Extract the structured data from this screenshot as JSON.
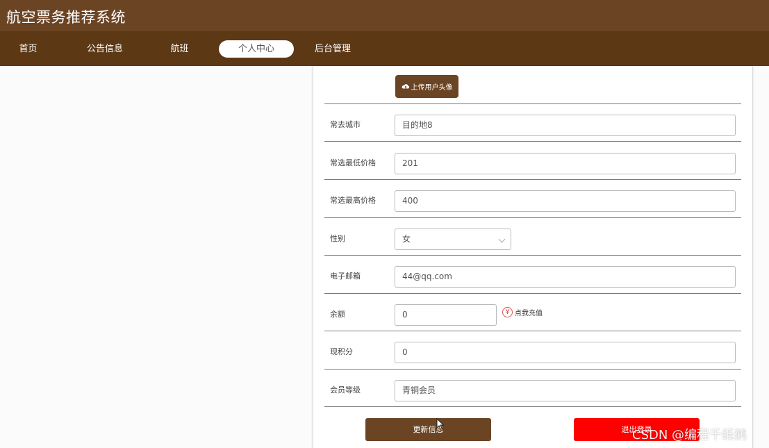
{
  "app": {
    "title": "航空票务推荐系统"
  },
  "nav": {
    "items": [
      {
        "label": "首页"
      },
      {
        "label": "公告信息"
      },
      {
        "label": "航班"
      },
      {
        "label": "个人中心",
        "active": true
      },
      {
        "label": "后台管理"
      }
    ]
  },
  "profile": {
    "upload_avatar_label": "上传用户头像",
    "fields": {
      "city": {
        "label": "常去城市",
        "value": "目的地8"
      },
      "min_price": {
        "label": "常选最低价格",
        "value": "201"
      },
      "max_price": {
        "label": "常选最高价格",
        "value": "400"
      },
      "gender": {
        "label": "性别",
        "value": "女"
      },
      "email": {
        "label": "电子邮箱",
        "value": "44@qq.com"
      },
      "balance": {
        "label": "余额",
        "value": "0"
      },
      "points": {
        "label": "现积分",
        "value": "0"
      },
      "level": {
        "label": "会员等级",
        "value": "青铜会员"
      }
    },
    "recharge_label": "点我充值",
    "recharge_icon_glyph": "¥"
  },
  "actions": {
    "update_label": "更新信息",
    "logout_label": "退出登录"
  },
  "watermark": "CSDN @编程千纸鹤",
  "colors": {
    "brand_brown": "#6b4424",
    "nav_brown": "#5c3815",
    "logout_red": "#ff0000"
  }
}
